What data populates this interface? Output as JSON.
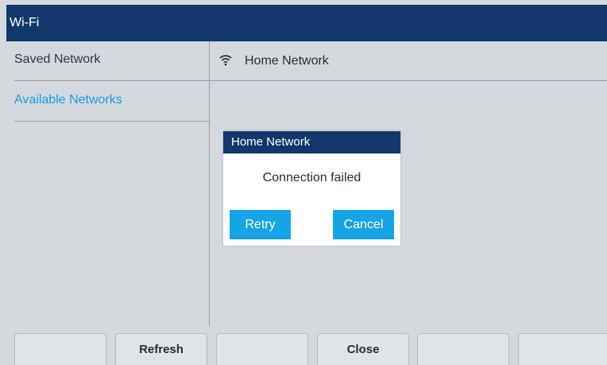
{
  "window": {
    "title": "Wi-Fi"
  },
  "sidebar": {
    "items": [
      {
        "label": "Saved Network",
        "selected": false
      },
      {
        "label": "Available Networks",
        "selected": true
      }
    ]
  },
  "main": {
    "network_icon": "wifi-icon",
    "network_name": "Home Network"
  },
  "dialog": {
    "title": "Home Network",
    "message": "Connection failed",
    "retry_label": "Retry",
    "cancel_label": "Cancel"
  },
  "softkeys": [
    {
      "label": ""
    },
    {
      "label": "Refresh"
    },
    {
      "label": ""
    },
    {
      "label": "Close"
    },
    {
      "label": ""
    },
    {
      "label": ""
    }
  ],
  "colors": {
    "titlebar": "#12386b",
    "background": "#d3d9dc",
    "accent": "#17a4e6",
    "selected_text": "#1a9be0"
  }
}
